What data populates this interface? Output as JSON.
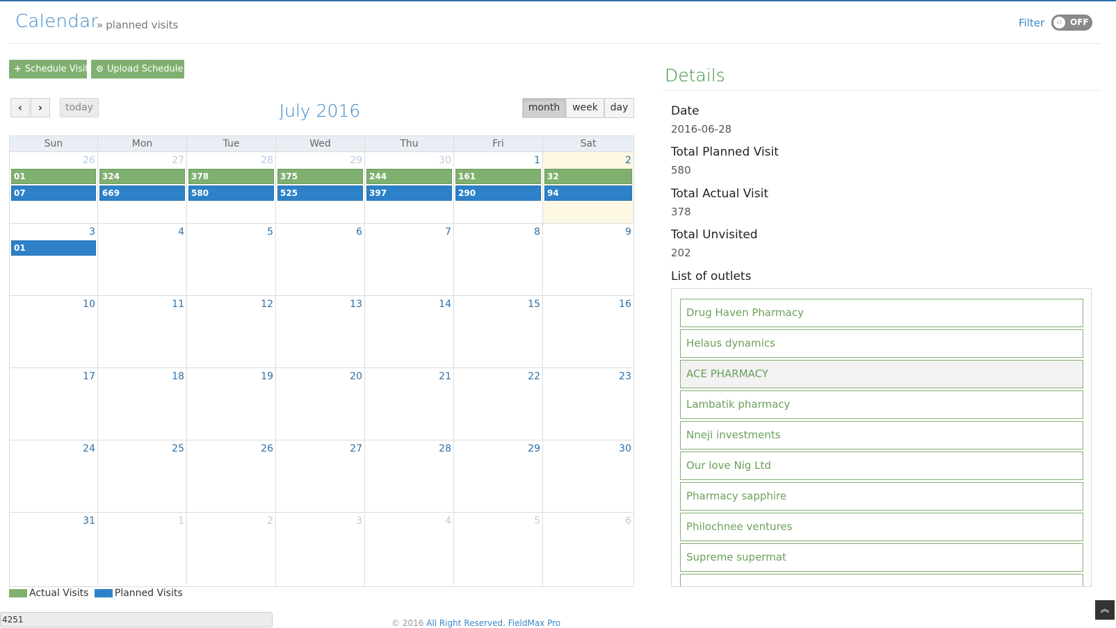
{
  "header": {
    "title": "Calendar",
    "breadcrumb": "planned visits",
    "filter_label": "Filter",
    "toggle_state": "OFF"
  },
  "toolbar": {
    "schedule_label": "Schedule Visit",
    "upload_label": "Upload Schedule"
  },
  "calendar": {
    "title": "July 2016",
    "prev_icon": "‹",
    "next_icon": "›",
    "today_label": "today",
    "views": [
      "month",
      "week",
      "day"
    ],
    "active_view": "month",
    "weekdays": [
      "Sun",
      "Mon",
      "Tue",
      "Wed",
      "Thu",
      "Fri",
      "Sat"
    ],
    "weeks": [
      [
        {
          "d": "26",
          "other": true,
          "actual": "01",
          "planned": "07"
        },
        {
          "d": "27",
          "other": true,
          "actual": "324",
          "planned": "669"
        },
        {
          "d": "28",
          "other": true,
          "actual": "378",
          "planned": "580"
        },
        {
          "d": "29",
          "other": true,
          "actual": "375",
          "planned": "525"
        },
        {
          "d": "30",
          "other": true,
          "actual": "244",
          "planned": "397"
        },
        {
          "d": "1",
          "other": false,
          "actual": "161",
          "planned": "290"
        },
        {
          "d": "2",
          "other": false,
          "today": true,
          "actual": "32",
          "planned": "94"
        }
      ],
      [
        {
          "d": "3",
          "other": false,
          "planned": "01"
        },
        {
          "d": "4",
          "other": false
        },
        {
          "d": "5",
          "other": false
        },
        {
          "d": "6",
          "other": false
        },
        {
          "d": "7",
          "other": false
        },
        {
          "d": "8",
          "other": false
        },
        {
          "d": "9",
          "other": false
        }
      ],
      [
        {
          "d": "10"
        },
        {
          "d": "11"
        },
        {
          "d": "12"
        },
        {
          "d": "13"
        },
        {
          "d": "14"
        },
        {
          "d": "15"
        },
        {
          "d": "16"
        }
      ],
      [
        {
          "d": "17"
        },
        {
          "d": "18"
        },
        {
          "d": "19"
        },
        {
          "d": "20"
        },
        {
          "d": "21"
        },
        {
          "d": "22"
        },
        {
          "d": "23"
        }
      ],
      [
        {
          "d": "24"
        },
        {
          "d": "25"
        },
        {
          "d": "26"
        },
        {
          "d": "27"
        },
        {
          "d": "28"
        },
        {
          "d": "29"
        },
        {
          "d": "30"
        }
      ],
      [
        {
          "d": "31",
          "other": false
        },
        {
          "d": "1",
          "other": true
        },
        {
          "d": "2",
          "other": true
        },
        {
          "d": "3",
          "other": true
        },
        {
          "d": "4",
          "other": true
        },
        {
          "d": "5",
          "other": true
        },
        {
          "d": "6",
          "other": true
        }
      ]
    ]
  },
  "legend": {
    "actual": "Actual Visits",
    "planned": "Planned Visits",
    "actual_color": "#7fb06f",
    "planned_color": "#2d81c8"
  },
  "details": {
    "title": "Details",
    "date_label": "Date",
    "date_value": "2016-06-28",
    "planned_label": "Total Planned Visit",
    "planned_value": "580",
    "actual_label": "Total Actual Visit",
    "actual_value": "378",
    "unvisited_label": "Total Unvisited",
    "unvisited_value": "202",
    "outlets_label": "List of outlets",
    "outlets": [
      "Drug Haven Pharmacy",
      "Helaus dynamics",
      "ACE PHARMACY",
      "Lambatik pharmacy",
      "Nneji investments",
      "Our love Nig Ltd",
      "Pharmacy sapphire",
      "Philochnee ventures",
      "Supreme supermat"
    ]
  },
  "footer": {
    "strip_text": "4251",
    "copyright_prefix": "© 2016",
    "copyright_link": "All Right Reserved. FieldMax Pro"
  }
}
